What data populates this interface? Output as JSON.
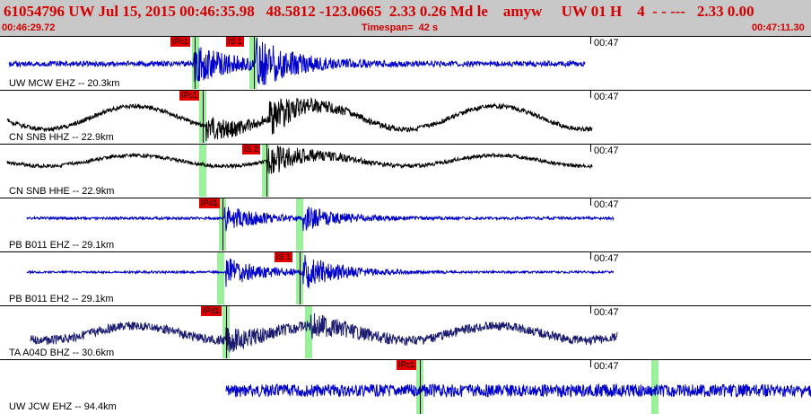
{
  "header": {
    "title": "61054796 UW Jul 15, 2015 00:46:35.98   48.5812 -123.0665  2.33 0.26 Md le    amyw     UW 01 H    4  - - ---   2.33 0.00",
    "start_time": "00:46:29.72",
    "timespan": "Timespan=  42 s",
    "end_time": "00:47:11.30"
  },
  "colors": {
    "header_bg": "#c8c8c8",
    "header_text": "#d40000",
    "trace_blue": "#0000cc",
    "trace_black": "#000000",
    "trace_navy": "#191970",
    "pick_bg": "#e00000",
    "window_green": "#90ee90"
  },
  "panels": [
    {
      "station": "UW MCW EHZ -- 20.3km",
      "time_label": "00:47",
      "picks": [
        "IPc1",
        "IS 1"
      ]
    },
    {
      "station": "CN SNB HHZ -- 22.9km",
      "time_label": "00:47",
      "picks": [
        "IPc1"
      ]
    },
    {
      "station": "CN SNB HHE -- 22.9km",
      "time_label": "00:47",
      "picks": [
        "IS 2"
      ]
    },
    {
      "station": "PB B011 EHZ -- 29.1km",
      "time_label": "00:47",
      "picks": [
        "IPd1"
      ]
    },
    {
      "station": "PB B011 EH2 -- 29.1km",
      "time_label": "00:47",
      "picks": [
        "IS 1"
      ]
    },
    {
      "station": "TA A04D BHZ -- 30.6km",
      "time_label": "00:47",
      "picks": [
        "IPd1"
      ]
    },
    {
      "station": "UW JCW EHZ -- 94.4km",
      "time_label": "00:47",
      "picks": [
        "IPc1"
      ]
    }
  ]
}
